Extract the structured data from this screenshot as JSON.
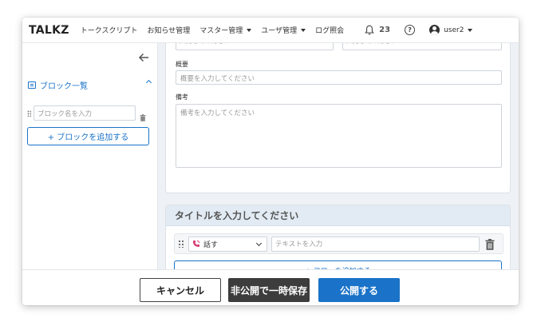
{
  "navbar": {
    "brand": "TALKZ",
    "items": [
      {
        "label": "トークスクリプト",
        "dropdown": false
      },
      {
        "label": "お知らせ管理",
        "dropdown": false
      },
      {
        "label": "マスター管理",
        "dropdown": true
      },
      {
        "label": "ユーザ管理",
        "dropdown": true
      },
      {
        "label": "ログ照会",
        "dropdown": false
      }
    ],
    "notification_count": "23",
    "help_glyph": "?",
    "user_name": "user2"
  },
  "sidebar": {
    "section_title": "ブロック一覧",
    "block_name_placeholder": "ブロック名を入力",
    "add_block_label": "+ ブロックを追加する"
  },
  "main": {
    "top_inputs": [
      {
        "placeholder": "入力してください"
      },
      {
        "placeholder": "入力してください"
      }
    ],
    "summary": {
      "label": "概要",
      "placeholder": "概要を入力してください"
    },
    "notes": {
      "label": "備考",
      "placeholder": "備考を入力してください"
    },
    "flow_card": {
      "title_placeholder": "タイトルを入力してください",
      "flow_type": "話す",
      "text_placeholder": "テキストを入力",
      "add_flow_label": "+ フローを追加する"
    }
  },
  "footer": {
    "cancel_label": "キャンセル",
    "draft_label": "非公開で一時保存",
    "publish_label": "公開する"
  },
  "colors": {
    "accent": "#1a73c8",
    "dark_button": "#3d3d3d",
    "background": "#eef1f5",
    "phone_icon": "#d9346b"
  }
}
